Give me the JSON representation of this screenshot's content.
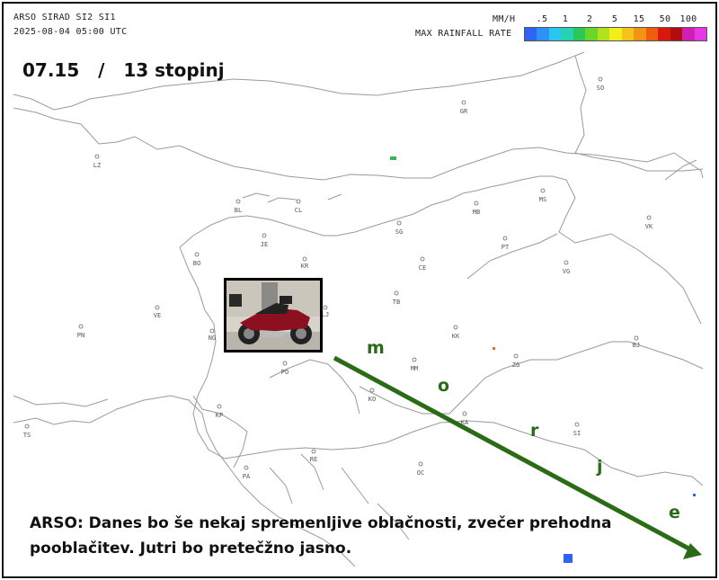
{
  "header": {
    "line1": "ARSO SIRAD SI2 SI1",
    "line2": "2025-08-04 05:00 UTC",
    "unit": "MM/H",
    "rate_label": "MAX RAINFALL RATE",
    "ticks": [
      ".5",
      "1",
      "2",
      "5",
      "15",
      "50",
      "100"
    ],
    "scale_colors": [
      "#2f63f5",
      "#2c92f5",
      "#29c6f0",
      "#27d2b4",
      "#28c95a",
      "#69d629",
      "#b3e21d",
      "#f0ee1c",
      "#f6c418",
      "#f39514",
      "#ef5c10",
      "#d8180d",
      "#b30c0c",
      "#d11fb4",
      "#e738e6"
    ]
  },
  "overlay": {
    "time": "07.15",
    "sep": "/",
    "temperature": "13 stopinj",
    "forecast": "ARSO: Danes bo še nekaj spremenljive oblačnosti, zvečer prehodna pooblačitev. Jutri bo pretečžno jasno.",
    "arrow_word": [
      "m",
      "o",
      "r",
      "j",
      "e"
    ],
    "arrow_color": "#2a6b15"
  },
  "cities": [
    "SO",
    "GR",
    "LZ",
    "MS",
    "BL",
    "CL",
    "MB",
    "VK",
    "JE",
    "SG",
    "PT",
    "BO",
    "KR",
    "CE",
    "VG",
    "LJ",
    "TB",
    "VE",
    "PN",
    "NG",
    "KK",
    "BJ",
    "MM",
    "ZG",
    "PO",
    "KO",
    "KA",
    "KP",
    "SI",
    "TS",
    "RE",
    "OC",
    "PA"
  ]
}
